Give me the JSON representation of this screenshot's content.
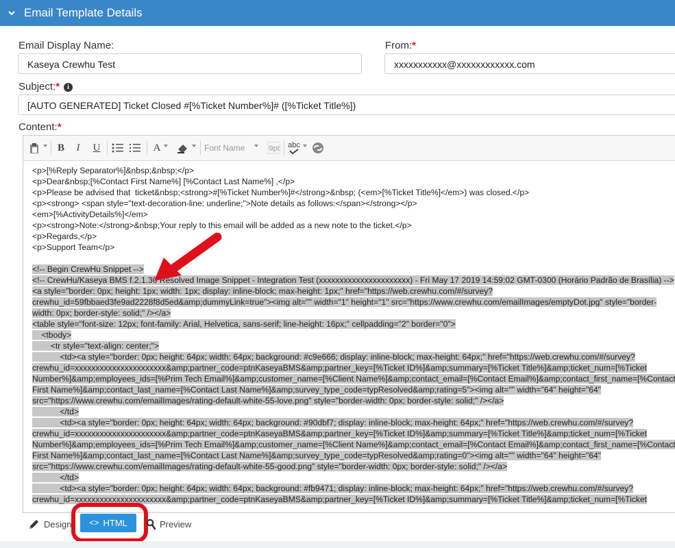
{
  "header": {
    "title": "Email Template Details"
  },
  "form": {
    "display_name_label": "Email Display Name:",
    "display_name_value": "Kaseya Crewhu Test",
    "from_label": "From:",
    "from_value": "xxxxxxxxxxx@xxxxxxxxxxxx.com",
    "subject_label": "Subject:",
    "subject_value": "[AUTO GENERATED] Ticket Closed #[%Ticket Number%]# ([%Ticket Title%])",
    "content_label": "Content:",
    "required_mark": "*",
    "info_glyph": "i"
  },
  "toolbar": {
    "bold": "B",
    "italic": "I",
    "underline": "U",
    "font_color": "A",
    "font_name": "Font Name",
    "font_size": "9pt",
    "spellcheck": "abc"
  },
  "editor_lines": [
    {
      "text": "<p>[%Reply Separator%]&nbsp;&nbsp;</p>",
      "sel": false
    },
    {
      "text": "<p>Dear&nbsp;[%Contact First Name%] [%Contact Last Name%] ,</p>",
      "sel": false
    },
    {
      "text": "<p>Please be advised that  ticket&nbsp;<strong>#[%Ticket Number%]#</strong>&nbsp; (<em>[%Ticket Title%]</em>) was closed.</p>",
      "sel": false
    },
    {
      "text": "<p><strong> <span style=\"text-decoration-line: underline;\">Note details as follows:</span></strong></p>",
      "sel": false
    },
    {
      "text": "<em>[%ActivityDetails%]</em>",
      "sel": false
    },
    {
      "text": "<p><strong>Note:</strong>&nbsp;Your reply to this email will be added as a new note to the ticket.</p>",
      "sel": false
    },
    {
      "text": "<p>Regards,</p>",
      "sel": false
    },
    {
      "text": "<p>Support Team</p>",
      "sel": false
    },
    {
      "text": "",
      "sel": false
    },
    {
      "text": "<!-- Begin CrewHu Snippet -->",
      "sel": true
    },
    {
      "text": "<!-- CrewHu/Kaseya BMS f.2.1.30 Resolved Image Snippet - Integration Test (xxxxxxxxxxxxxxxxxxxxxx) - Fri May 17 2019 14:59:02 GMT-0300 (Horário Padrão de Brasília) -->",
      "sel": true
    },
    {
      "text": "<a style=\"border: 0px; height: 1px; width: 1px; display: inline-block; max-height: 1px;\" href=\"https://web.crewhu.com/#/survey?",
      "sel": true
    },
    {
      "text": "crewhu_id=59fbbaed3fe9ad2228f8d5ed&amp;dummyLink=true\"><img alt=\"\" width=\"1\" height=\"1\" src=\"https://www.crewhu.com/emailImages/emptyDot.jpg\" style=\"border-",
      "sel": true
    },
    {
      "text": "width: 0px; border-style: solid;\" /></a>",
      "sel": true
    },
    {
      "text": "<table style=\"font-size: 12px; font-family: Arial, Helvetica, sans-serif; line-height: 16px;\" cellpadding=\"2\" border=\"0\">",
      "sel": true
    },
    {
      "text": "    <tbody>",
      "sel": true
    },
    {
      "text": "        <tr style=\"text-align: center;\">",
      "sel": true
    },
    {
      "text": "            <td><a style=\"border: 0px; height: 64px; width: 64px; background: #c9e666; display: inline-block; max-height: 64px;\" href=\"https://web.crewhu.com/#/survey?",
      "sel": true
    },
    {
      "text": "crewhu_id=xxxxxxxxxxxxxxxxxxxxxx&amp;partner_code=ptnKaseyaBMS&amp;partner_key=[%Ticket ID%]&amp;summary=[%Ticket Title%]&amp;ticket_num=[%Ticket",
      "sel": true
    },
    {
      "text": "Number%]&amp;employees_ids=[%Prim Tech Email%]&amp;customer_name=[%Client Name%]&amp;contact_email=[%Contact Email%]&amp;contact_first_name=[%Contact",
      "sel": true
    },
    {
      "text": "First Name%]&amp;contact_last_name=[%Contact Last Name%]&amp;survey_type_code=typResolved&amp;rating=5\"><img alt=\"\" width=\"64\" height=\"64\"",
      "sel": true
    },
    {
      "text": "src=\"https://www.crewhu.com/emailImages/rating-default-white-55-love.png\" style=\"border-width: 0px; border-style: solid;\" /></a>",
      "sel": true
    },
    {
      "text": "            </td>",
      "sel": true
    },
    {
      "text": "            <td><a style=\"border: 0px; height: 64px; width: 64px; background: #90dbf7; display: inline-block; max-height: 64px;\" href=\"https://web.crewhu.com/#/survey?",
      "sel": true
    },
    {
      "text": "crewhu_id=xxxxxxxxxxxxxxxxxxxxxx&amp;partner_code=ptnKaseyaBMS&amp;partner_key=[%Ticket ID%]&amp;summary=[%Ticket Title%]&amp;ticket_num=[%Ticket",
      "sel": true
    },
    {
      "text": "Number%]&amp;employees_ids=[%Prim Tech Email%]&amp;customer_name=[%Client Name%]&amp;contact_email=[%Contact Email%]&amp;contact_first_name=[%Contact",
      "sel": true
    },
    {
      "text": "First Name%]&amp;contact_last_name=[%Contact Last Name%]&amp;survey_type_code=typResolved&amp;rating=0\"><img alt=\"\" width=\"64\" height=\"64\"",
      "sel": true
    },
    {
      "text": "src=\"https://www.crewhu.com/emailImages/rating-default-white-55-good.png\" style=\"border-width: 0px; border-style: solid;\" /></a>",
      "sel": true
    },
    {
      "text": "            </td>",
      "sel": true
    },
    {
      "text": "            <td><a style=\"border: 0px; height: 64px; width: 64px; background: #fb9471; display: inline-block; max-height: 64px;\" href=\"https://web.crewhu.com/#/survey?",
      "sel": true
    },
    {
      "text": "crewhu_id=xxxxxxxxxxxxxxxxxxxxxx&amp;partner_code=ptnKaseyaBMS&amp;partner_key=[%Ticket ID%]&amp;summary=[%Ticket Title%]&amp;ticket_num=[%Ticket",
      "sel": true
    }
  ],
  "mode_tabs": {
    "design": "Design",
    "html": "HTML",
    "preview": "Preview"
  },
  "icons": {
    "header": "chevron-down-icon",
    "paste": "paste-icon",
    "bullets": "bulleted-list-icon",
    "numbers": "numbered-list-icon",
    "highlight": "highlight-icon",
    "link": "link-icon",
    "design": "pencil-icon",
    "html": "code-icon",
    "preview": "magnifier-icon",
    "annotation": "red-arrow-icon"
  },
  "colors": {
    "header": "#3a87c8",
    "selection": "#c7c7c7",
    "required": "#e0201b",
    "html_tab": "#2b93de",
    "annotation": "#e0101a"
  }
}
